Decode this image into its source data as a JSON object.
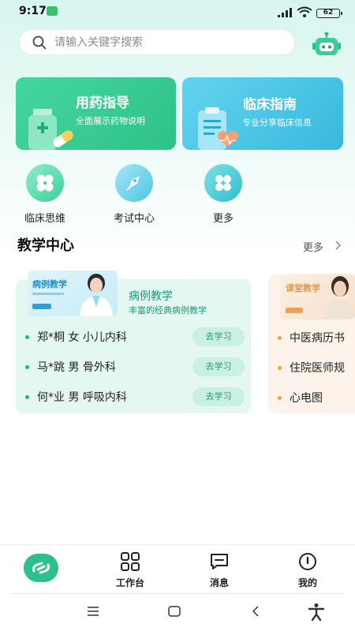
{
  "status_bar": {
    "time": "9:17",
    "battery": "62"
  },
  "search": {
    "placeholder": "请输入关键字搜索"
  },
  "feature_cards": [
    {
      "title": "用药指导",
      "subtitle": "全面展示药物说明"
    },
    {
      "title": "临床指南",
      "subtitle": "专业分享临床信息"
    }
  ],
  "quick_entries": [
    {
      "label": "临床思维"
    },
    {
      "label": "考试中心"
    },
    {
      "label": "更多"
    }
  ],
  "teaching": {
    "section_title": "教学中心",
    "more_label": "更多",
    "cards": [
      {
        "banner_tag": "病例教学",
        "title": "病例教学",
        "subtitle": "丰富的经典病例教学",
        "cases": [
          {
            "text": "郑*桐 女 小儿内科",
            "action": "去学习"
          },
          {
            "text": "马*跳 男 骨外科",
            "action": "去学习"
          },
          {
            "text": "何*业 男 呼吸内科",
            "action": "去学习"
          }
        ]
      },
      {
        "banner_tag": "课堂教学",
        "cases": [
          {
            "text": "中医病历书"
          },
          {
            "text": "住院医师规"
          },
          {
            "text": "心电图"
          }
        ]
      }
    ]
  },
  "bottom_nav": {
    "items": [
      {
        "label": ""
      },
      {
        "label": "工作台"
      },
      {
        "label": "消息"
      },
      {
        "label": "我的"
      }
    ]
  },
  "colors": {
    "primary_green": "#2cc08a",
    "card_green": "#3fd09a",
    "card_blue": "#4cc6e6",
    "teach_bg": "#e4f7f1",
    "teach_bg_2": "#fdf3ea"
  }
}
